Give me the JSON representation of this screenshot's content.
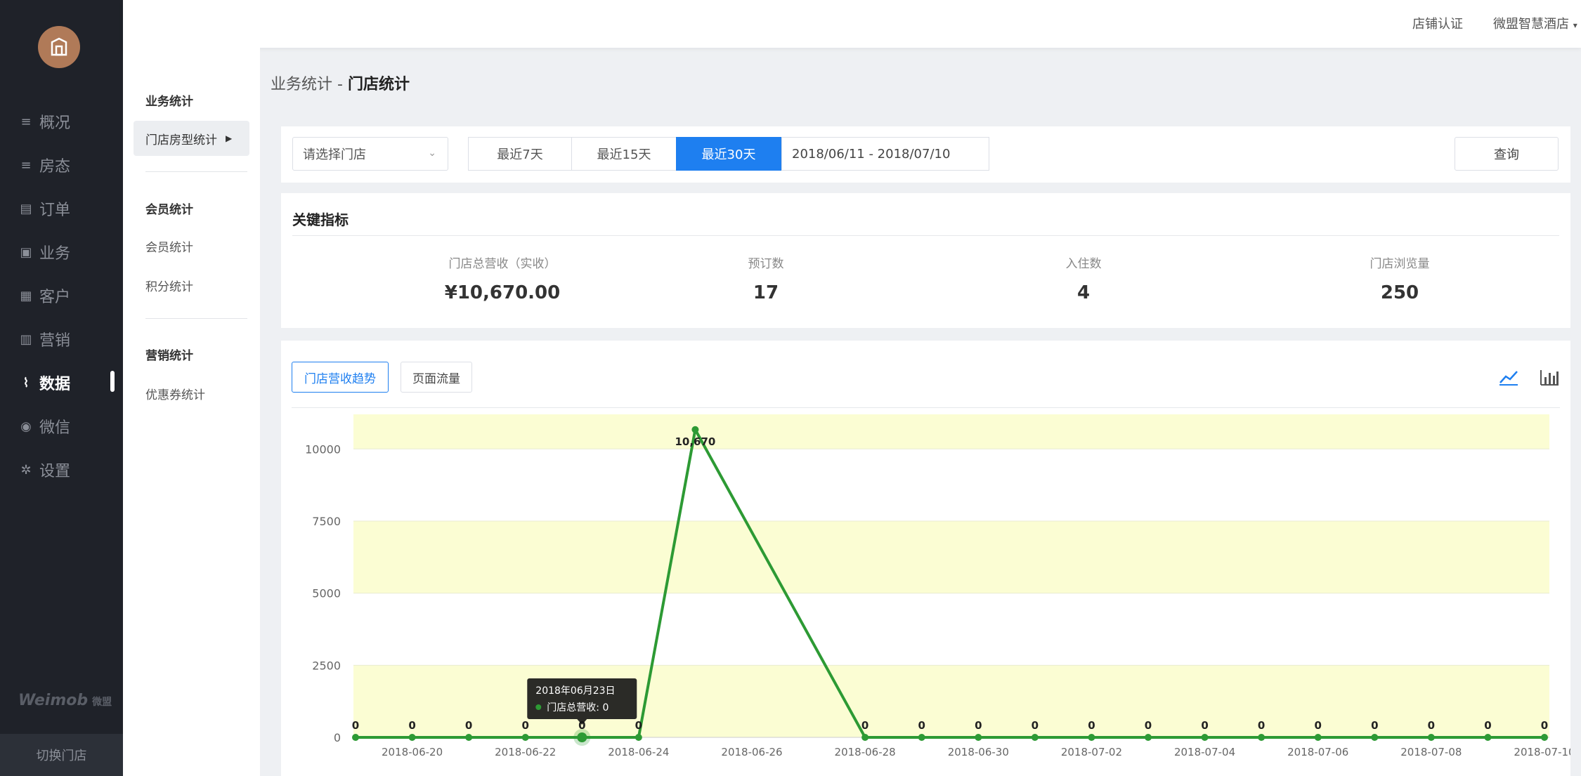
{
  "nav": {
    "items": [
      {
        "icon": "list-icon",
        "label": "概况"
      },
      {
        "icon": "list-icon",
        "label": "房态"
      },
      {
        "icon": "document-icon",
        "label": "订单"
      },
      {
        "icon": "briefcase-icon",
        "label": "业务"
      },
      {
        "icon": "card-icon",
        "label": "客户"
      },
      {
        "icon": "bar-chart-icon",
        "label": "营销"
      },
      {
        "icon": "trend-icon",
        "label": "数据"
      },
      {
        "icon": "wechat-icon",
        "label": "微信"
      },
      {
        "icon": "gear-icon",
        "label": "设置"
      }
    ],
    "active_index": 6,
    "brand": "Weimob",
    "brand_sub": "微盟",
    "switch_store": "切换门店"
  },
  "topbar": {
    "shop_cert": "店铺认证",
    "account": "微盟智慧酒店"
  },
  "subnav": {
    "business_group": "业务统计",
    "room_type_stats": "门店房型统计",
    "member_group": "会员统计",
    "member_stats": "会员统计",
    "points_stats": "积分统计",
    "marketing_group": "营销统计",
    "coupon_stats": "优惠券统计"
  },
  "breadcrumb": {
    "parent": "业务统计",
    "separator": " - ",
    "current": "门店统计"
  },
  "filter": {
    "store_placeholder": "请选择门店",
    "ranges": [
      "最近7天",
      "最近15天",
      "最近30天"
    ],
    "active_range": 2,
    "date_range": "2018/06/11 - 2018/07/10",
    "query_label": "查询"
  },
  "kpi": {
    "title": "关键指标",
    "items": [
      {
        "label": "门店总营收（实收）",
        "value": "¥10,670.00"
      },
      {
        "label": "预订数",
        "value": "17"
      },
      {
        "label": "入住数",
        "value": "4"
      },
      {
        "label": "门店浏览量",
        "value": "250"
      }
    ]
  },
  "chart_tabs": {
    "revenue_trend": "门店营收趋势",
    "page_traffic": "页面流量"
  },
  "tooltip": {
    "date": "2018年06月23日",
    "series": "门店总营收",
    "value": "0"
  },
  "colors": {
    "line": "#2d9a34",
    "band": "#fbfdd3",
    "accent": "#1e7ff0"
  },
  "chart_data": {
    "type": "line",
    "x": [
      "2018-06-19",
      "2018-06-20",
      "2018-06-21",
      "2018-06-22",
      "2018-06-23",
      "2018-06-24",
      "2018-06-25",
      "2018-06-28",
      "2018-06-29",
      "2018-06-30",
      "2018-07-01",
      "2018-07-02",
      "2018-07-03",
      "2018-07-04",
      "2018-07-05",
      "2018-07-06",
      "2018-07-07",
      "2018-07-08",
      "2018-07-09",
      "2018-07-10"
    ],
    "series": [
      {
        "name": "门店总营收",
        "values": [
          0,
          0,
          0,
          0,
          0,
          0,
          10670,
          0,
          0,
          0,
          0,
          0,
          0,
          0,
          0,
          0,
          0,
          0,
          0,
          0
        ]
      }
    ],
    "x_tick_labels": [
      "2018-06-20",
      "2018-06-22",
      "2018-06-24",
      "2018-06-26",
      "2018-06-28",
      "2018-06-30",
      "2018-07-02",
      "2018-07-04",
      "2018-07-06",
      "2018-07-08",
      "2018-07-10"
    ],
    "y_ticks": [
      0,
      2500,
      5000,
      7500,
      10000
    ],
    "ylim": [
      0,
      11200
    ],
    "data_labels": [
      "0",
      "0",
      "0",
      "0",
      "0",
      "0",
      "10,670",
      "0",
      "0",
      "0",
      "0",
      "0",
      "0",
      "0",
      "0",
      "0",
      "0",
      "0",
      "0",
      "0"
    ],
    "highlight_index": 4,
    "grid": "alternating bands"
  }
}
